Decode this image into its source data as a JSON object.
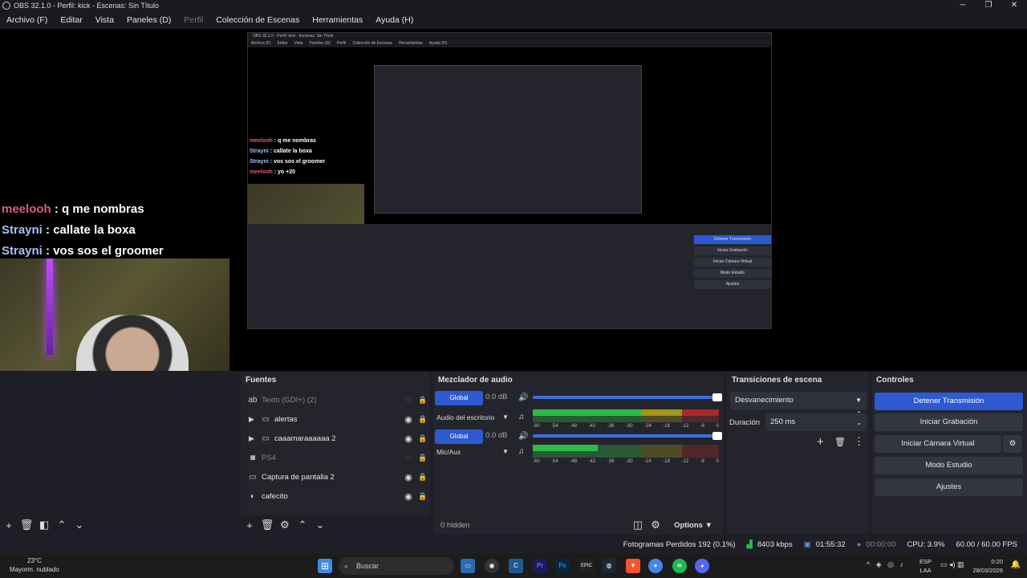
{
  "window": {
    "title": "OBS 32.1.0 - Perfil: kick - Escenas: Sin Título"
  },
  "menu": [
    "Archivo (F)",
    "Editar",
    "Vista",
    "Paneles (D)",
    "Perfil",
    "Colección de Escenas",
    "Herramientas",
    "Ayuda (H)"
  ],
  "chat": [
    {
      "user": "meelooh",
      "sep": " : ",
      "msg": "q me nombras"
    },
    {
      "user": "Strayni",
      "sep": " : ",
      "msg": "callate la boxa"
    },
    {
      "user": "Strayni",
      "sep": " : ",
      "msg": "vos sos el groomer"
    },
    {
      "user": "meelooh",
      "sep": " : ",
      "msg": "yo +20"
    }
  ],
  "sources": {
    "title": "Fuentes",
    "items": [
      {
        "label": "Texto (GDI+) (2)",
        "icon": "text-icon",
        "hidden": true
      },
      {
        "label": "alertas",
        "icon": "folder-icon",
        "hidden": false,
        "group": true
      },
      {
        "label": "caaamaraaaaaa 2",
        "icon": "folder-icon",
        "hidden": false,
        "group": true
      },
      {
        "label": "PS4",
        "icon": "camera-icon",
        "hidden": true
      },
      {
        "label": "Captura de pantalla 2",
        "icon": "monitor-icon",
        "hidden": false
      },
      {
        "label": "cafecito",
        "icon": "browser-icon",
        "hidden": false
      }
    ]
  },
  "mixer": {
    "title": "Mezclador de audio",
    "channels": [
      {
        "badge": "Global",
        "db": "0.0 dB",
        "name": "Audio del escritorio"
      },
      {
        "badge": "Global",
        "db": "0.0 dB",
        "name": "Mic/Aux"
      }
    ],
    "scale": [
      "-60",
      "-54",
      "-48",
      "-42",
      "-36",
      "-30",
      "-24",
      "-18",
      "-12",
      "-6",
      "0"
    ],
    "hidden": "0 hidden",
    "options": "Options"
  },
  "transitions": {
    "title": "Transiciones de escena",
    "selected": "Desvanecimiento",
    "duration_label": "Duración",
    "duration": "250 ms"
  },
  "controls": {
    "title": "Controles",
    "buttons": [
      "Detener Transmisión",
      "Iniciar Grabación",
      "Iniciar Cámara Virtual",
      "Modo Estudio",
      "Ajustes"
    ]
  },
  "status": {
    "dropped": "Fotogramas Perdidos 192 (0.1%)",
    "bitrate": "8403 kbps",
    "live_time": "01:55:32",
    "rec_time": "00:00:00",
    "cpu": "CPU: 3.9%",
    "fps": "60.00 / 60.00 FPS"
  },
  "taskbar": {
    "temp": "23°C",
    "weather": "Mayorm. nublado",
    "search": "Buscar",
    "lang1": "ESP",
    "lang2": "LAA",
    "time": "0:20",
    "date": "28/03/2026"
  }
}
